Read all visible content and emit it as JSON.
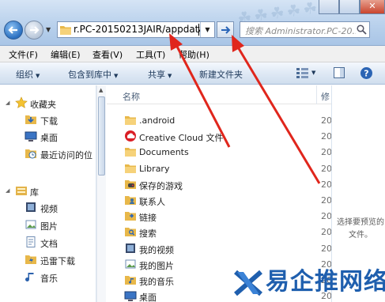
{
  "window": {
    "close_glyph": "✕"
  },
  "address_bar": {
    "path": "r.PC-20150213JAIR/appdata",
    "search_placeholder": "搜索 Administrator.PC-20..."
  },
  "menu": [
    "文件(F)",
    "编辑(E)",
    "查看(V)",
    "工具(T)",
    "帮助(H)"
  ],
  "toolbar": {
    "organize": "组织",
    "include_in_library": "包含到库中",
    "share": "共享",
    "new_folder": "新建文件夹"
  },
  "nav_pane": {
    "favorites_header": "收藏夹",
    "favorites": [
      "下载",
      "桌面",
      "最近访问的位"
    ],
    "libraries_header": "库",
    "libraries": [
      "视频",
      "图片",
      "文档",
      "迅雷下载",
      "音乐"
    ]
  },
  "file_list": {
    "column_name": "名称",
    "column_date": "修",
    "items": [
      {
        "name": ".android",
        "icon": "folder-icon",
        "date": "20"
      },
      {
        "name": "Creative Cloud 文件",
        "icon": "creative-cloud-icon",
        "date": "20"
      },
      {
        "name": "Documents",
        "icon": "folder-icon",
        "date": "20"
      },
      {
        "name": "Library",
        "icon": "folder-icon",
        "date": "20"
      },
      {
        "name": "保存的游戏",
        "icon": "saved-games-icon",
        "date": "20"
      },
      {
        "name": "联系人",
        "icon": "contacts-icon",
        "date": "20"
      },
      {
        "name": "链接",
        "icon": "links-icon",
        "date": "20"
      },
      {
        "name": "搜索",
        "icon": "searches-icon",
        "date": "20"
      },
      {
        "name": "我的视频",
        "icon": "my-videos-icon",
        "date": "20"
      },
      {
        "name": "我的图片",
        "icon": "my-pictures-icon",
        "date": "20"
      },
      {
        "name": "我的音乐",
        "icon": "my-music-icon",
        "date": "20"
      },
      {
        "name": "桌面",
        "icon": "desktop-icon",
        "date": "20"
      }
    ]
  },
  "preview_pane": {
    "message": "选择要预览的文件。"
  },
  "watermark": {
    "brand_text": "易企推网络"
  },
  "colors": {
    "accent": "#1f5fae",
    "annotation_arrow": "#e0261c",
    "folder": "#f2c45a"
  }
}
